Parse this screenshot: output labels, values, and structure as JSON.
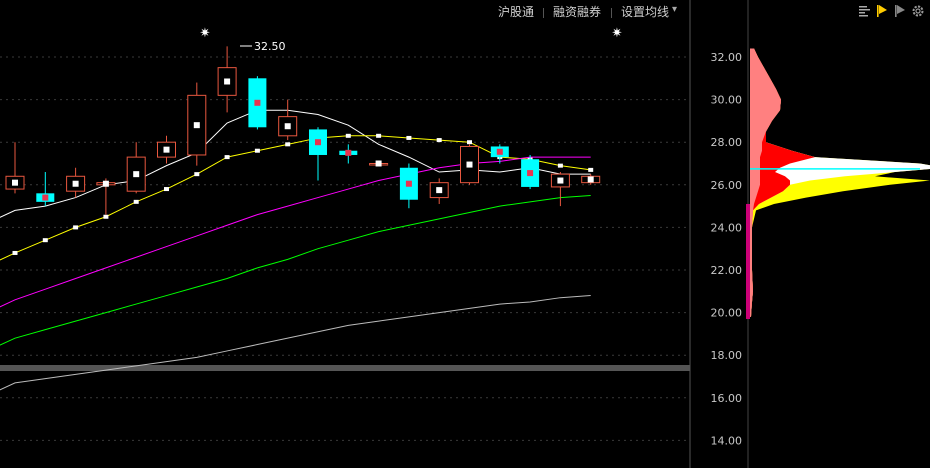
{
  "toolbar": {
    "items": [
      "沪股通",
      "融资融券",
      "设置均线"
    ],
    "dropdown_symbol": "▾"
  },
  "right_icons": [
    "bars-icon",
    "flag-yellow-icon",
    "flag-gray-icon",
    "gear-icon"
  ],
  "marks": {
    "star_symbol": "✷",
    "high_label": "32.50"
  },
  "colors": {
    "background": "#000000",
    "up": "#e8573f",
    "down": "#00ffff",
    "ma5": "#ffffff",
    "ma10": "#ffff00",
    "ma20": "#ff00ff",
    "ma30": "#00ff00",
    "ma60": "#bbbbbb",
    "grid": "#3a3a3a",
    "axis_text": "#c8c8c8"
  },
  "chart_data": {
    "type": "candlestick",
    "price_axis": {
      "ticks": [
        "32.00",
        "30.00",
        "28.00",
        "26.00",
        "24.00",
        "22.00",
        "20.00",
        "18.00",
        "16.00",
        "14.00"
      ],
      "ylim": [
        13.3,
        33.3
      ]
    },
    "candles": [
      {
        "o": 25.8,
        "c": 26.4,
        "h": 28.0,
        "l": 25.6
      },
      {
        "o": 25.6,
        "c": 25.2,
        "h": 26.6,
        "l": 25.0
      },
      {
        "o": 25.7,
        "c": 26.4,
        "h": 26.8,
        "l": 25.4
      },
      {
        "o": 26.0,
        "c": 26.1,
        "h": 26.3,
        "l": 24.6
      },
      {
        "o": 25.7,
        "c": 27.3,
        "h": 28.0,
        "l": 25.6
      },
      {
        "o": 27.3,
        "c": 28.0,
        "h": 28.3,
        "l": 27.0
      },
      {
        "o": 27.4,
        "c": 30.2,
        "h": 30.8,
        "l": 26.9
      },
      {
        "o": 30.2,
        "c": 31.5,
        "h": 32.5,
        "l": 29.4
      },
      {
        "o": 31.0,
        "c": 28.7,
        "h": 31.1,
        "l": 28.6
      },
      {
        "o": 28.3,
        "c": 29.2,
        "h": 30.0,
        "l": 28.1
      },
      {
        "o": 28.6,
        "c": 27.4,
        "h": 28.7,
        "l": 26.2
      },
      {
        "o": 27.6,
        "c": 27.4,
        "h": 27.9,
        "l": 27.0
      },
      {
        "o": 27.0,
        "c": 27.0,
        "h": 27.1,
        "l": 26.9
      },
      {
        "o": 26.8,
        "c": 25.3,
        "h": 27.0,
        "l": 24.9
      },
      {
        "o": 25.4,
        "c": 26.1,
        "h": 26.3,
        "l": 25.1
      },
      {
        "o": 26.1,
        "c": 27.8,
        "h": 27.9,
        "l": 26.0
      },
      {
        "o": 27.8,
        "c": 27.3,
        "h": 27.9,
        "l": 27.0
      },
      {
        "o": 27.2,
        "c": 25.9,
        "h": 27.4,
        "l": 25.8
      },
      {
        "o": 25.9,
        "c": 26.5,
        "h": 26.6,
        "l": 25.0
      },
      {
        "o": 26.1,
        "c": 26.4,
        "h": 26.5,
        "l": 26.0
      }
    ],
    "moving_averages": [
      {
        "key": "ma5",
        "values": [
          24.8,
          25.0,
          25.4,
          26.0,
          26.2,
          26.9,
          27.5,
          28.9,
          29.5,
          29.5,
          29.3,
          28.8,
          27.9,
          27.3,
          26.6,
          26.7,
          26.6,
          26.8,
          26.5,
          26.5
        ]
      },
      {
        "key": "ma10",
        "values": [
          22.8,
          23.4,
          24.0,
          24.5,
          25.2,
          25.8,
          26.5,
          27.3,
          27.6,
          27.9,
          28.2,
          28.3,
          28.3,
          28.2,
          28.1,
          28.0,
          27.3,
          27.2,
          26.9,
          26.7
        ]
      },
      {
        "key": "ma20",
        "values": [
          20.6,
          21.1,
          21.6,
          22.1,
          22.6,
          23.1,
          23.6,
          24.1,
          24.6,
          25.0,
          25.4,
          25.8,
          26.2,
          26.5,
          26.8,
          27.0,
          27.1,
          27.3,
          27.3,
          27.3
        ]
      },
      {
        "key": "ma30",
        "values": [
          18.8,
          19.2,
          19.6,
          20.0,
          20.4,
          20.8,
          21.2,
          21.6,
          22.1,
          22.5,
          23.0,
          23.4,
          23.8,
          24.1,
          24.4,
          24.7,
          25.0,
          25.2,
          25.4,
          25.5
        ]
      },
      {
        "key": "ma60",
        "values": [
          16.7,
          16.9,
          17.1,
          17.3,
          17.5,
          17.7,
          17.9,
          18.2,
          18.5,
          18.8,
          19.1,
          19.4,
          19.6,
          19.8,
          20.0,
          20.2,
          20.4,
          20.5,
          20.7,
          20.8
        ]
      }
    ],
    "volume_profile": [
      {
        "price": 32.4,
        "pink": 4,
        "red": 0,
        "white": 0,
        "yellow": 0
      },
      {
        "price": 32.0,
        "pink": 8,
        "red": 0,
        "white": 0,
        "yellow": 0
      },
      {
        "price": 31.5,
        "pink": 14,
        "red": 0,
        "white": 0,
        "yellow": 0
      },
      {
        "price": 31.0,
        "pink": 20,
        "red": 0,
        "white": 0,
        "yellow": 0
      },
      {
        "price": 30.5,
        "pink": 26,
        "red": 0,
        "white": 0,
        "yellow": 0
      },
      {
        "price": 30.0,
        "pink": 31,
        "red": 0,
        "white": 0,
        "yellow": 0
      },
      {
        "price": 29.5,
        "pink": 30,
        "red": 0,
        "white": 0,
        "yellow": 0
      },
      {
        "price": 29.0,
        "pink": 22,
        "red": 0,
        "white": 0,
        "yellow": 0
      },
      {
        "price": 28.5,
        "pink": 16,
        "red": 0,
        "white": 0,
        "yellow": 0
      },
      {
        "price": 28.0,
        "pink": 12,
        "red": 4,
        "white": 0,
        "yellow": 0
      },
      {
        "price": 27.6,
        "pink": 12,
        "red": 30,
        "white": 0,
        "yellow": 0
      },
      {
        "price": 27.3,
        "pink": 10,
        "red": 55,
        "white": 0,
        "yellow": 0
      },
      {
        "price": 27.0,
        "pink": 10,
        "red": 30,
        "white": 130,
        "yellow": 0
      },
      {
        "price": 26.8,
        "pink": 10,
        "red": 20,
        "white": 165,
        "yellow": 0
      },
      {
        "price": 26.6,
        "pink": 10,
        "red": 15,
        "white": 120,
        "yellow": 0
      },
      {
        "price": 26.4,
        "pink": 10,
        "red": 25,
        "white": 60,
        "yellow": 30
      },
      {
        "price": 26.2,
        "pink": 10,
        "red": 30,
        "white": 20,
        "yellow": 120
      },
      {
        "price": 26.0,
        "pink": 10,
        "red": 30,
        "white": 0,
        "yellow": 100
      },
      {
        "price": 25.7,
        "pink": 8,
        "red": 25,
        "white": 0,
        "yellow": 60
      },
      {
        "price": 25.4,
        "pink": 6,
        "red": 15,
        "white": 0,
        "yellow": 35
      },
      {
        "price": 25.1,
        "pink": 4,
        "red": 5,
        "white": 0,
        "yellow": 15
      },
      {
        "price": 24.8,
        "pink": 3,
        "red": 0,
        "white": 0,
        "yellow": 3
      },
      {
        "price": 24.0,
        "pink": 2,
        "red": 0,
        "white": 0,
        "yellow": 0
      },
      {
        "price": 22.0,
        "pink": 2,
        "red": 0,
        "white": 0,
        "yellow": 0
      },
      {
        "price": 21.0,
        "pink": 3,
        "red": 0,
        "white": 0,
        "yellow": 0
      },
      {
        "price": 20.5,
        "pink": 2,
        "red": 0,
        "white": 0,
        "yellow": 0
      },
      {
        "price": 19.8,
        "pink": 1,
        "red": 0,
        "white": 0,
        "yellow": 0
      }
    ]
  }
}
